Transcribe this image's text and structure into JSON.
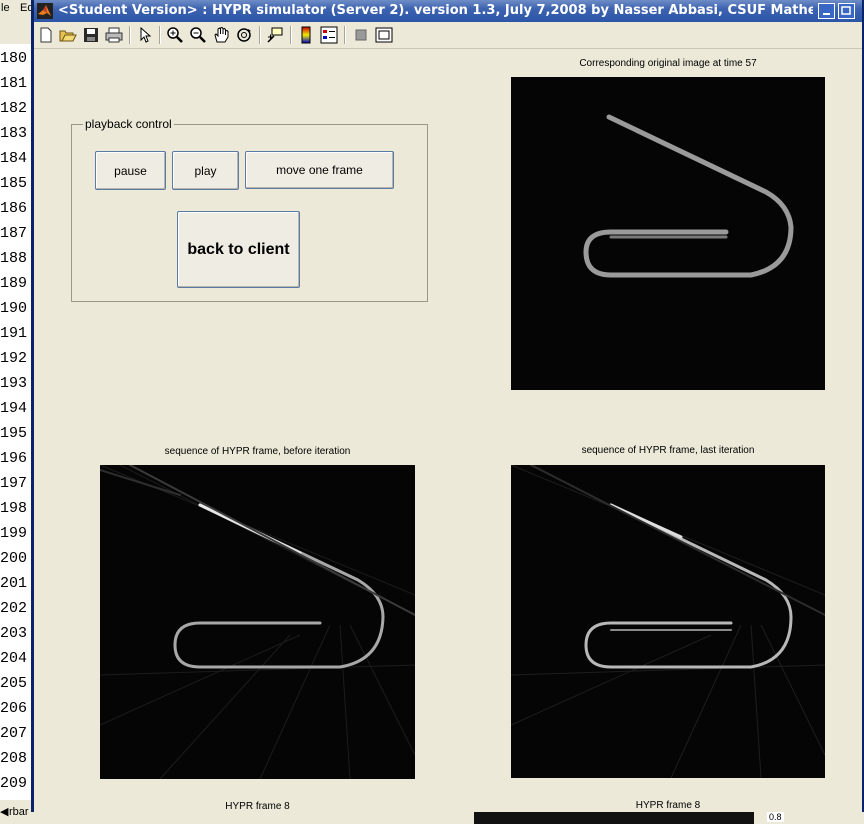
{
  "background_app": {
    "menu_items": [
      "le",
      "Ed"
    ],
    "line_numbers": [
      "180",
      "181",
      "182",
      "183",
      "184",
      "185",
      "186",
      "187",
      "188",
      "189",
      "190",
      "191",
      "192",
      "193",
      "194",
      "195",
      "196",
      "197",
      "198",
      "199",
      "200",
      "201",
      "202",
      "203",
      "204",
      "205",
      "206",
      "207",
      "208",
      "209"
    ],
    "bottom_tab_label": "rbar",
    "corner_value": "0.8"
  },
  "window": {
    "title": "<Student Version> : HYPR simulator (Server 2). version 1.3, July 7,2008 by Nasser Abbasi, CSUF Mathematics departm..."
  },
  "toolbar": {
    "items": [
      "new-figure",
      "open-file",
      "save",
      "print",
      "edit-plot",
      "zoom-in",
      "zoom-out",
      "pan",
      "rotate-3d",
      "data-cursor",
      "insert-colorbar",
      "insert-legend",
      "hide-plot-tools",
      "show-plot-tools"
    ]
  },
  "playback": {
    "title": "playback control",
    "pause_label": "pause",
    "play_label": "play",
    "step_label": "move one frame",
    "back_label": "back to client"
  },
  "axes": {
    "original_title": "Corresponding original image at time 57",
    "before_title": "sequence of HYPR frame, before iteration",
    "last_title": "sequence of HYPR frame, last iteration",
    "before_xlabel": "HYPR frame 8",
    "last_xlabel": "HYPR frame 8"
  },
  "colors": {
    "title_bar": "#2c56a8",
    "figure_bg": "#ece9d8",
    "image_bg": "#050505"
  }
}
